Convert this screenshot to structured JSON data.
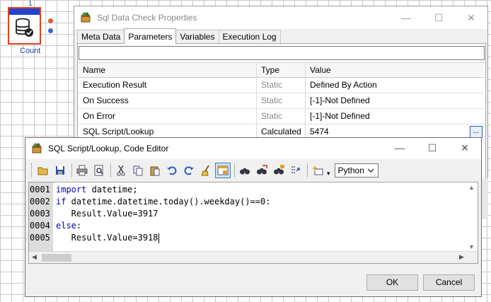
{
  "canvas": {
    "node_index": "1",
    "node_label": "Count"
  },
  "properties_window": {
    "title": "Sql Data Check Properties",
    "tabs": [
      {
        "label": "Meta Data",
        "active": false
      },
      {
        "label": "Parameters",
        "active": true
      },
      {
        "label": "Variables",
        "active": false
      },
      {
        "label": "Execution Log",
        "active": false
      }
    ],
    "columns": [
      "Name",
      "Type",
      "Value"
    ],
    "rows": [
      {
        "name": "Execution Result",
        "type": "Static",
        "value": "Defined By Action"
      },
      {
        "name": "On Success",
        "type": "Static",
        "value": "[-1]-Not Defined"
      },
      {
        "name": "On Error",
        "type": "Static",
        "value": "[-1]-Not Defined"
      },
      {
        "name": "SQL Script/Lookup",
        "type": "Calculated",
        "value": "5474"
      }
    ],
    "ellipsis_label": "..."
  },
  "editor_window": {
    "title": "SQL Script/Lookup, Code Editor",
    "language": "Python",
    "toolbar_icons": [
      "open-folder-icon",
      "save-icon",
      "print-icon",
      "print-preview-icon",
      "cut-icon",
      "copy-icon",
      "paste-icon",
      "undo-icon",
      "redo-icon",
      "clear-icon",
      "toggle-view-icon",
      "find-icon",
      "find-next-icon",
      "replace-icon",
      "goto-icon",
      "insert-icon"
    ],
    "lines": [
      {
        "num": "0001",
        "kw": "import",
        "text": " datetime;"
      },
      {
        "num": "0002",
        "kw": "if",
        "text": " datetime.datetime.today().weekday()==0:"
      },
      {
        "num": "0003",
        "kw": "",
        "text": "   Result.Value=3917"
      },
      {
        "num": "0004",
        "kw": "else",
        "text": ":"
      },
      {
        "num": "0005",
        "kw": "",
        "text": "   Result.Value=3918"
      }
    ],
    "ok_label": "OK",
    "cancel_label": "Cancel"
  },
  "colors": {
    "node_border": "#e04020",
    "node_bar": "#2244cc",
    "keyword": "#0000c8",
    "gutter": "#dcdcdc"
  }
}
